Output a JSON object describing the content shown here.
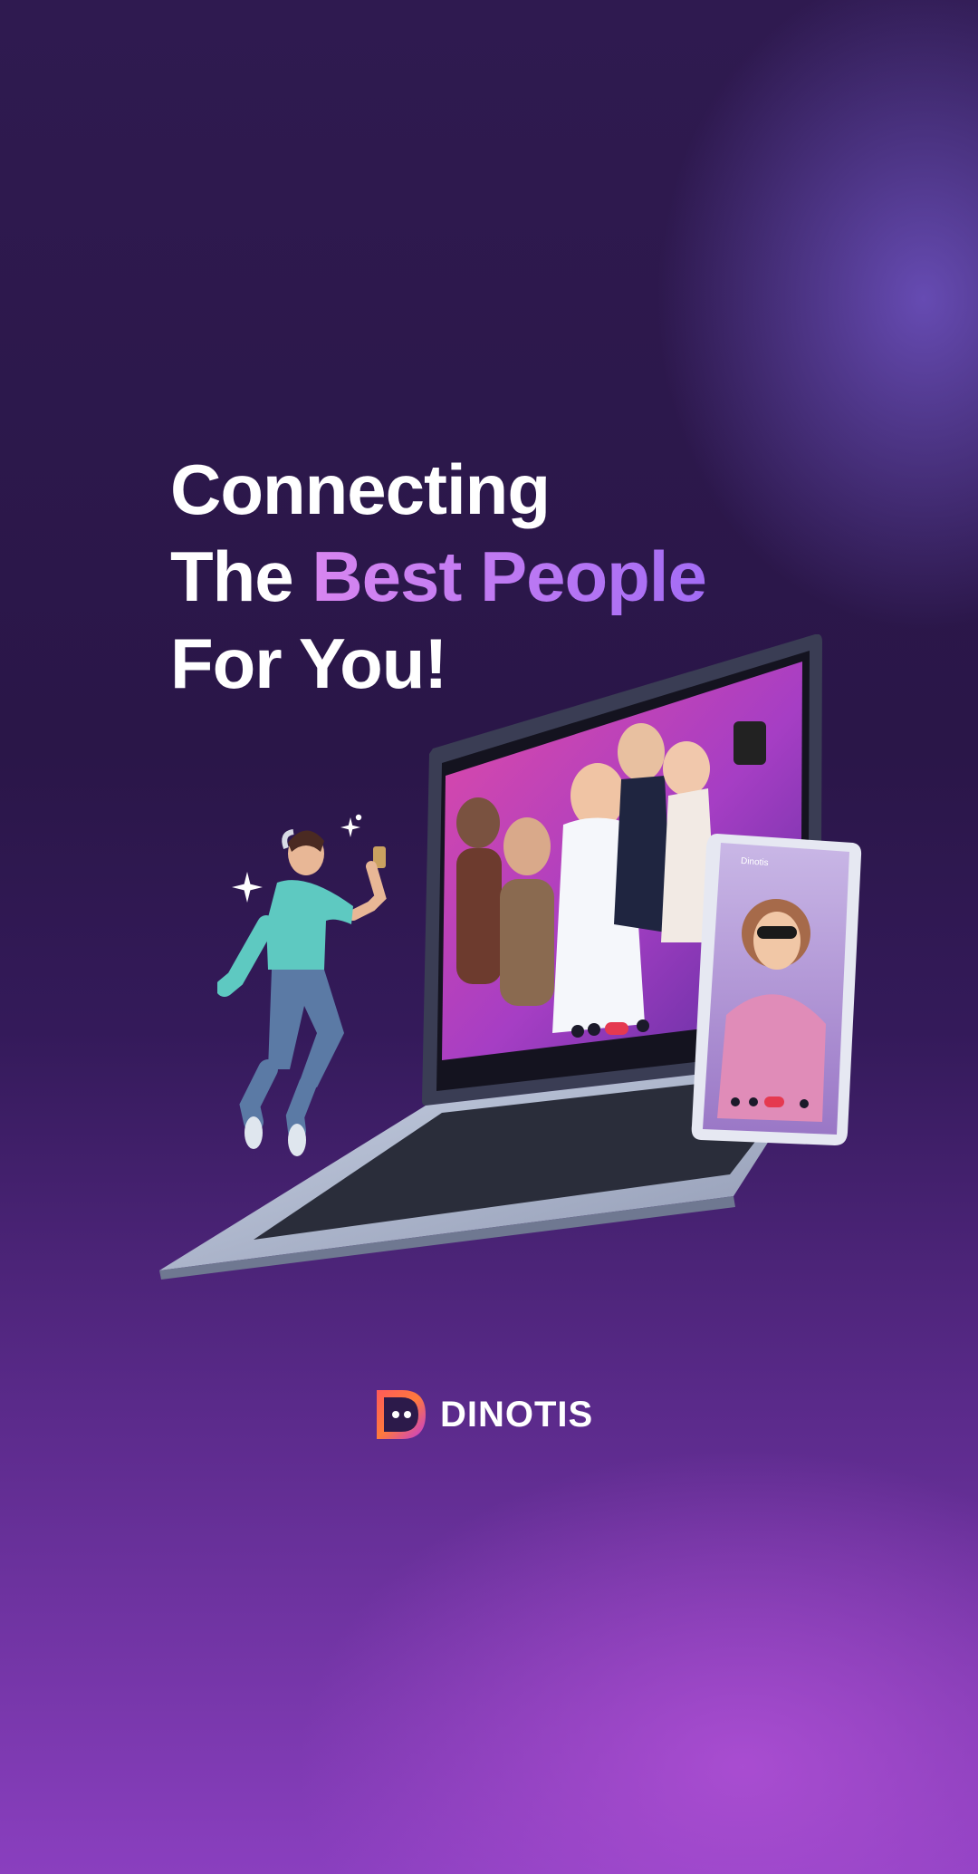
{
  "headline": {
    "line1": "Connecting",
    "line2_prefix": "The ",
    "line2_highlight": "Best People",
    "line3": "For You!"
  },
  "brand": {
    "name": "DINOTIS",
    "phone_label": "Dinotis"
  },
  "colors": {
    "highlight": "#c073f0",
    "end_call": "#e53950",
    "laptop_screen_bg": "#c23fb6"
  },
  "icons": [
    "sparkle-icon",
    "mic-icon",
    "camera-icon",
    "end-call-icon",
    "video-icon"
  ]
}
